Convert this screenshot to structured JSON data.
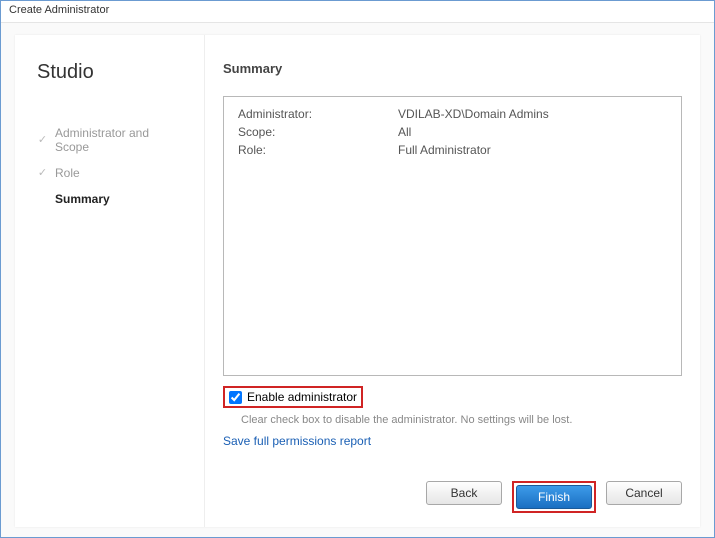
{
  "window": {
    "title": "Create Administrator"
  },
  "sidebar": {
    "title": "Studio",
    "steps": [
      {
        "label": "Administrator and Scope"
      },
      {
        "label": "Role"
      },
      {
        "label": "Summary"
      }
    ]
  },
  "main": {
    "heading": "Summary",
    "rows": [
      {
        "label": "Administrator:",
        "value": "VDILAB-XD\\Domain Admins"
      },
      {
        "label": "Scope:",
        "value": "All"
      },
      {
        "label": "Role:",
        "value": "Full Administrator"
      }
    ],
    "enable_label": "Enable administrator",
    "hint": "Clear check box to disable the administrator. No settings will be lost.",
    "link": "Save full permissions report"
  },
  "buttons": {
    "back": "Back",
    "finish": "Finish",
    "cancel": "Cancel"
  }
}
